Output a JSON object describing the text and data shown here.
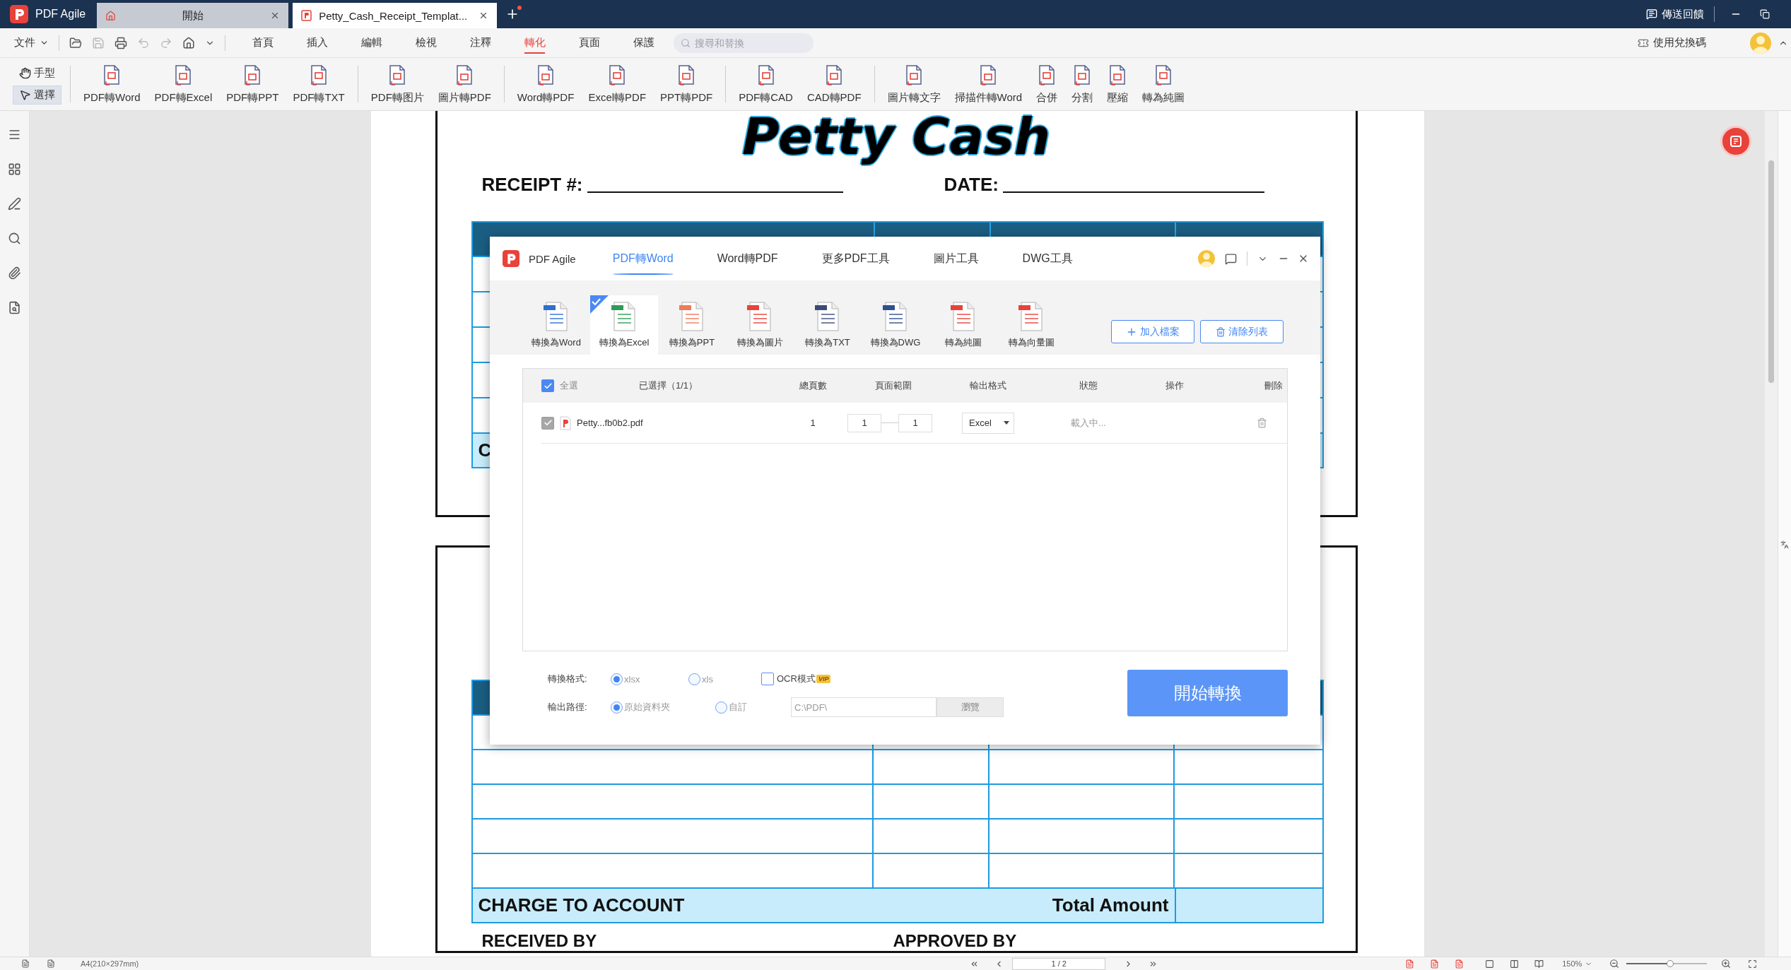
{
  "title_bar": {
    "app_name": "PDF Agile",
    "tabs": [
      {
        "label": "開始",
        "selected": false,
        "kind": "home"
      },
      {
        "label": "Petty_Cash_Receipt_Templat...",
        "selected": true,
        "kind": "document"
      }
    ],
    "feedback": "傳送回饋"
  },
  "menu_bar": {
    "file_menu": "文件",
    "tabs": [
      {
        "label": "首頁",
        "selected": false
      },
      {
        "label": "插入",
        "selected": false
      },
      {
        "label": "編輯",
        "selected": false
      },
      {
        "label": "檢視",
        "selected": false
      },
      {
        "label": "注釋",
        "selected": false
      },
      {
        "label": "轉化",
        "selected": true
      },
      {
        "label": "頁面",
        "selected": false
      },
      {
        "label": "保護",
        "selected": false
      }
    ],
    "search": {
      "placeholder": "搜尋和替換"
    },
    "redeem": "使用兌換碼"
  },
  "ribbon": {
    "modes": [
      {
        "label": "手型",
        "selected": false
      },
      {
        "label": "選擇",
        "selected": true
      }
    ],
    "tool_groups": [
      [
        "PDF轉Word",
        "PDF轉Excel",
        "PDF轉PPT",
        "PDF轉TXT"
      ],
      [
        "PDF轉图片",
        "圖片轉PDF"
      ],
      [
        "Word轉PDF",
        "Excel轉PDF",
        "PPT轉PDF"
      ],
      [
        "PDF轉CAD",
        "CAD轉PDF"
      ],
      [
        "圖片轉文字",
        "掃描件轉Word",
        "合併",
        "分割",
        "壓縮",
        "轉為純圖"
      ]
    ]
  },
  "document": {
    "receipt_1": {
      "title": "Petty Cash",
      "receipt_label": "RECEIPT #:",
      "date_label": "DATE:",
      "charge_fragment": "C"
    },
    "receipt_2": {
      "charge_label": "CHARGE TO ACCOUNT",
      "total_label": "Total Amount",
      "received_by": "RECEIVED BY",
      "approved_by": "APPROVED BY"
    }
  },
  "dialog": {
    "app_name": "PDF Agile",
    "tabs": [
      {
        "label": "PDF轉Word",
        "selected": true
      },
      {
        "label": "Word轉PDF",
        "selected": false
      },
      {
        "label": "更多PDF工具",
        "selected": false
      },
      {
        "label": "圖片工具",
        "selected": false
      },
      {
        "label": "DWG工具",
        "selected": false
      }
    ],
    "tools": [
      {
        "label": "轉換為Word",
        "selected": false
      },
      {
        "label": "轉換為Excel",
        "selected": true
      },
      {
        "label": "轉換為PPT",
        "selected": false
      },
      {
        "label": "轉換為圖片",
        "selected": false
      },
      {
        "label": "轉換為TXT",
        "selected": false
      },
      {
        "label": "轉換為DWG",
        "selected": false
      },
      {
        "label": "轉為純圖",
        "selected": false
      },
      {
        "label": "轉為向量圖",
        "selected": false
      }
    ],
    "add_files": "加入檔案",
    "clear_list": "清除列表",
    "table": {
      "select_all": {
        "label": "全選",
        "checked": true
      },
      "columns": [
        "已選擇（1/1）",
        "總頁數",
        "頁面範圍",
        "輸出格式",
        "狀態",
        "操作",
        "刪除"
      ],
      "rows": [
        {
          "checked": true,
          "disabled": true,
          "file": "Petty...fb0b2.pdf",
          "pages": "1",
          "range_from": "1",
          "range_to": "1",
          "format": "Excel",
          "status": "載入中..."
        }
      ]
    },
    "format": {
      "label": "轉換格式:",
      "options": [
        {
          "label": "xlsx",
          "selected": true
        },
        {
          "label": "xls",
          "selected": false
        }
      ],
      "ocr": {
        "label": "OCR模式",
        "checked": false,
        "badge": "VIP"
      }
    },
    "output": {
      "label": "輸出路徑:",
      "options": [
        {
          "label": "原始資料夾",
          "selected": true
        },
        {
          "label": "自訂",
          "selected": false
        }
      ],
      "path": "C:\\PDF\\",
      "browse": {
        "label": "瀏覽",
        "disabled": true
      }
    },
    "start": "開始轉換"
  },
  "status_bar": {
    "page_size": "A4(210×297mm)",
    "page": "1 / 2",
    "zoom": "150%",
    "zoom_slider": {
      "level": 0.54
    }
  }
}
